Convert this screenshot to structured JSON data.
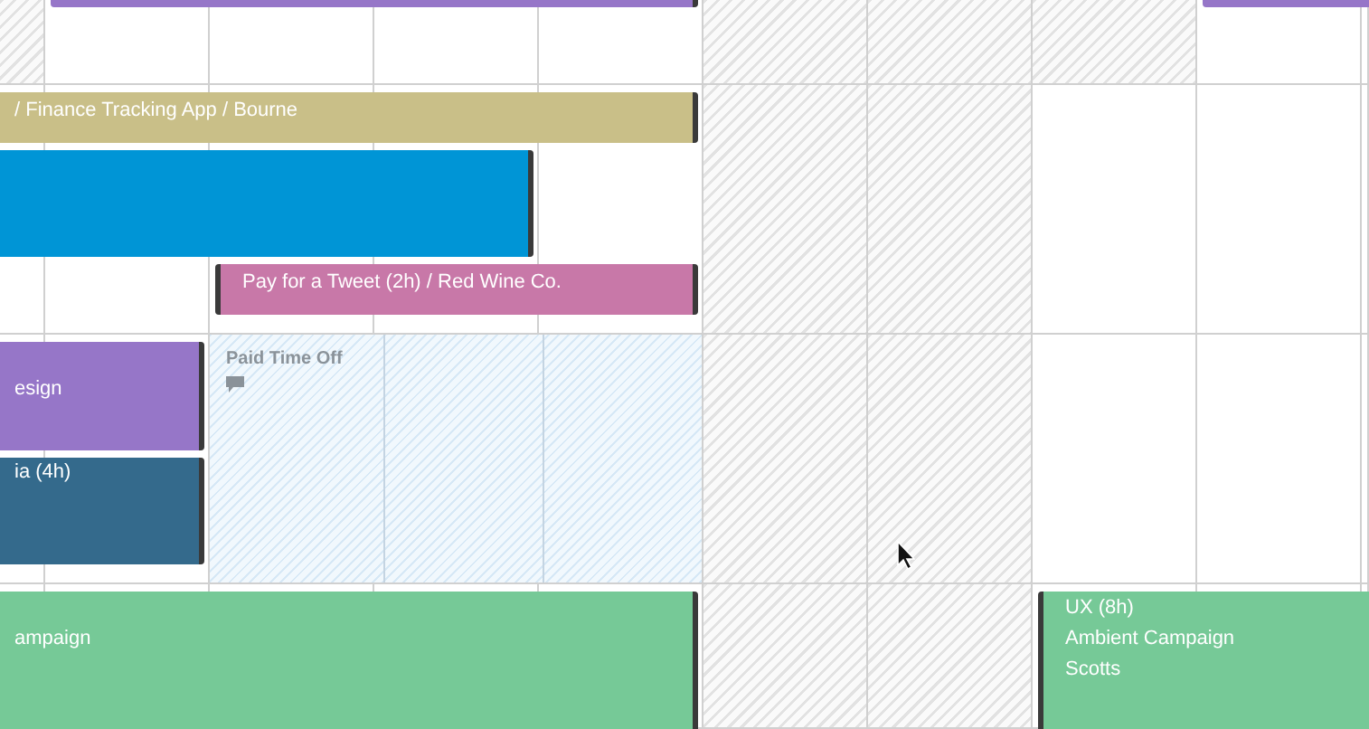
{
  "rows": [
    {
      "cells": [
        {
          "shaded": true
        },
        {
          "shaded": false
        },
        {
          "shaded": false
        },
        {
          "shaded": false
        },
        {
          "shaded": false
        },
        {
          "shaded": true
        },
        {
          "shaded": true
        },
        {
          "shaded": true
        },
        {
          "shaded": false
        },
        {
          "shaded": false
        }
      ]
    },
    {
      "cells": [
        {
          "shaded": false
        },
        {
          "shaded": false
        },
        {
          "shaded": false
        },
        {
          "shaded": false
        },
        {
          "shaded": false
        },
        {
          "shaded": true
        },
        {
          "shaded": true
        },
        {
          "shaded": false
        },
        {
          "shaded": false
        },
        {
          "shaded": false
        }
      ]
    },
    {
      "cells": [
        {
          "shaded": false
        },
        {
          "shaded": false
        },
        {
          "shaded": true
        },
        {
          "shaded": true
        },
        {
          "shaded": false
        },
        {
          "shaded": false
        },
        {
          "shaded": false
        }
      ],
      "time_off": {
        "label": "Paid Time Off"
      }
    },
    {
      "cells": [
        {
          "shaded": false
        },
        {
          "shaded": false
        },
        {
          "shaded": false
        },
        {
          "shaded": false
        },
        {
          "shaded": false
        },
        {
          "shaded": true
        },
        {
          "shaded": true
        },
        {
          "shaded": false
        },
        {
          "shaded": false
        },
        {
          "shaded": false
        }
      ]
    }
  ],
  "events": [
    {
      "color": "#9676c8"
    },
    {
      "color": "#9676c8"
    },
    {
      "color": "#c9bf88",
      "lines": [
        "/ Finance Tracking App / Bourne"
      ]
    },
    {
      "color": "#0095d6"
    },
    {
      "color": "#c878a8",
      "lines": [
        "Pay for a Tweet (2h) / Red Wine Co."
      ]
    },
    {
      "color": "#9676c8",
      "lines": [
        "esign"
      ]
    },
    {
      "color": "#346a8c",
      "lines": [
        "ia (4h)"
      ]
    },
    {
      "color": "#76c997",
      "lines": [
        "ampaign"
      ]
    },
    {
      "color": "#76c997",
      "lines": [
        "UX (8h)",
        "Ambient Campaign",
        "Scotts"
      ]
    }
  ]
}
